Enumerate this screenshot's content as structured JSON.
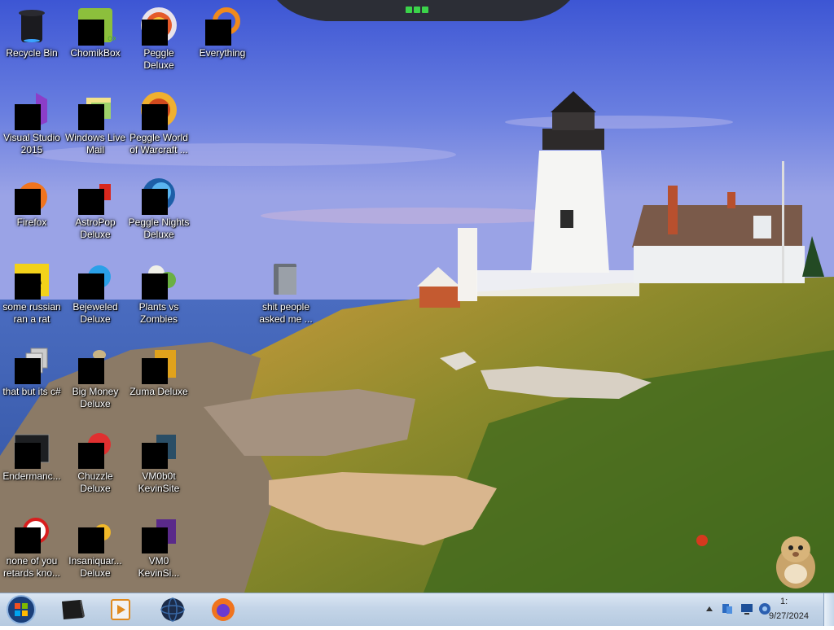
{
  "desktop": {
    "icons": [
      {
        "label": "Recycle Bin",
        "icon": "recycle-bin-icon"
      },
      {
        "label": "ChomikBox",
        "icon": "chomikbox-icon"
      },
      {
        "label": "Peggle Deluxe",
        "icon": "peggle-icon"
      },
      {
        "label": "Everything",
        "icon": "everything-search-icon"
      },
      {
        "label": "Visual Studio\n2015",
        "icon": "visual-studio-icon"
      },
      {
        "label": "Windows Live\nMail",
        "icon": "windows-live-mail-icon"
      },
      {
        "label": "Peggle World\nof Warcraft ...",
        "icon": "peggle-wow-icon"
      },
      {
        "label": "Firefox",
        "icon": "firefox-icon"
      },
      {
        "label": "AstroPop\nDeluxe",
        "icon": "astropop-icon"
      },
      {
        "label": "Peggle Nights\nDeluxe",
        "icon": "peggle-nights-icon"
      },
      {
        "label": "some russian\nran a rat",
        "icon": "folder-icon"
      },
      {
        "label": "Bejeweled\nDeluxe",
        "icon": "bejeweled-icon"
      },
      {
        "label": "Plants vs\nZombies",
        "icon": "plants-vs-zombies-icon"
      },
      {
        "label": "shit people\nasked me ...",
        "icon": "folder-icon"
      },
      {
        "label": "that but its c#",
        "icon": "copy-folder-icon"
      },
      {
        "label": "Big Money\nDeluxe",
        "icon": "big-money-icon"
      },
      {
        "label": "Zuma Deluxe",
        "icon": "zuma-icon"
      },
      {
        "label": "Endermanc...",
        "icon": "terminal-icon"
      },
      {
        "label": "Chuzzle\nDeluxe",
        "icon": "chuzzle-icon"
      },
      {
        "label": "VM0b0t\nKevinSite",
        "icon": "vm-icon"
      },
      {
        "label": "none of you\nretards kno...",
        "icon": "app-icon"
      },
      {
        "label": "Insaniquar...\nDeluxe",
        "icon": "insaniquarium-icon"
      },
      {
        "label": "VM0\nKevinSi...",
        "icon": "vm-icon"
      }
    ]
  },
  "taskbar": {
    "start": "windows-start-orb-icon",
    "pinned": [
      {
        "icon": "windows-explorer-icon"
      },
      {
        "icon": "media-player-icon"
      },
      {
        "icon": "globe-icon"
      },
      {
        "icon": "firefox-icon"
      }
    ],
    "tray": {
      "icons": [
        "show-hidden-icons-arrow",
        "network-icon",
        "display-icon",
        "volume-icon"
      ],
      "time": "1:",
      "date": "9/27/2024"
    }
  },
  "colors": {
    "taskbar": "#c4d5e8",
    "sky": "#5a6fd6",
    "sea": "#3a64b8"
  }
}
